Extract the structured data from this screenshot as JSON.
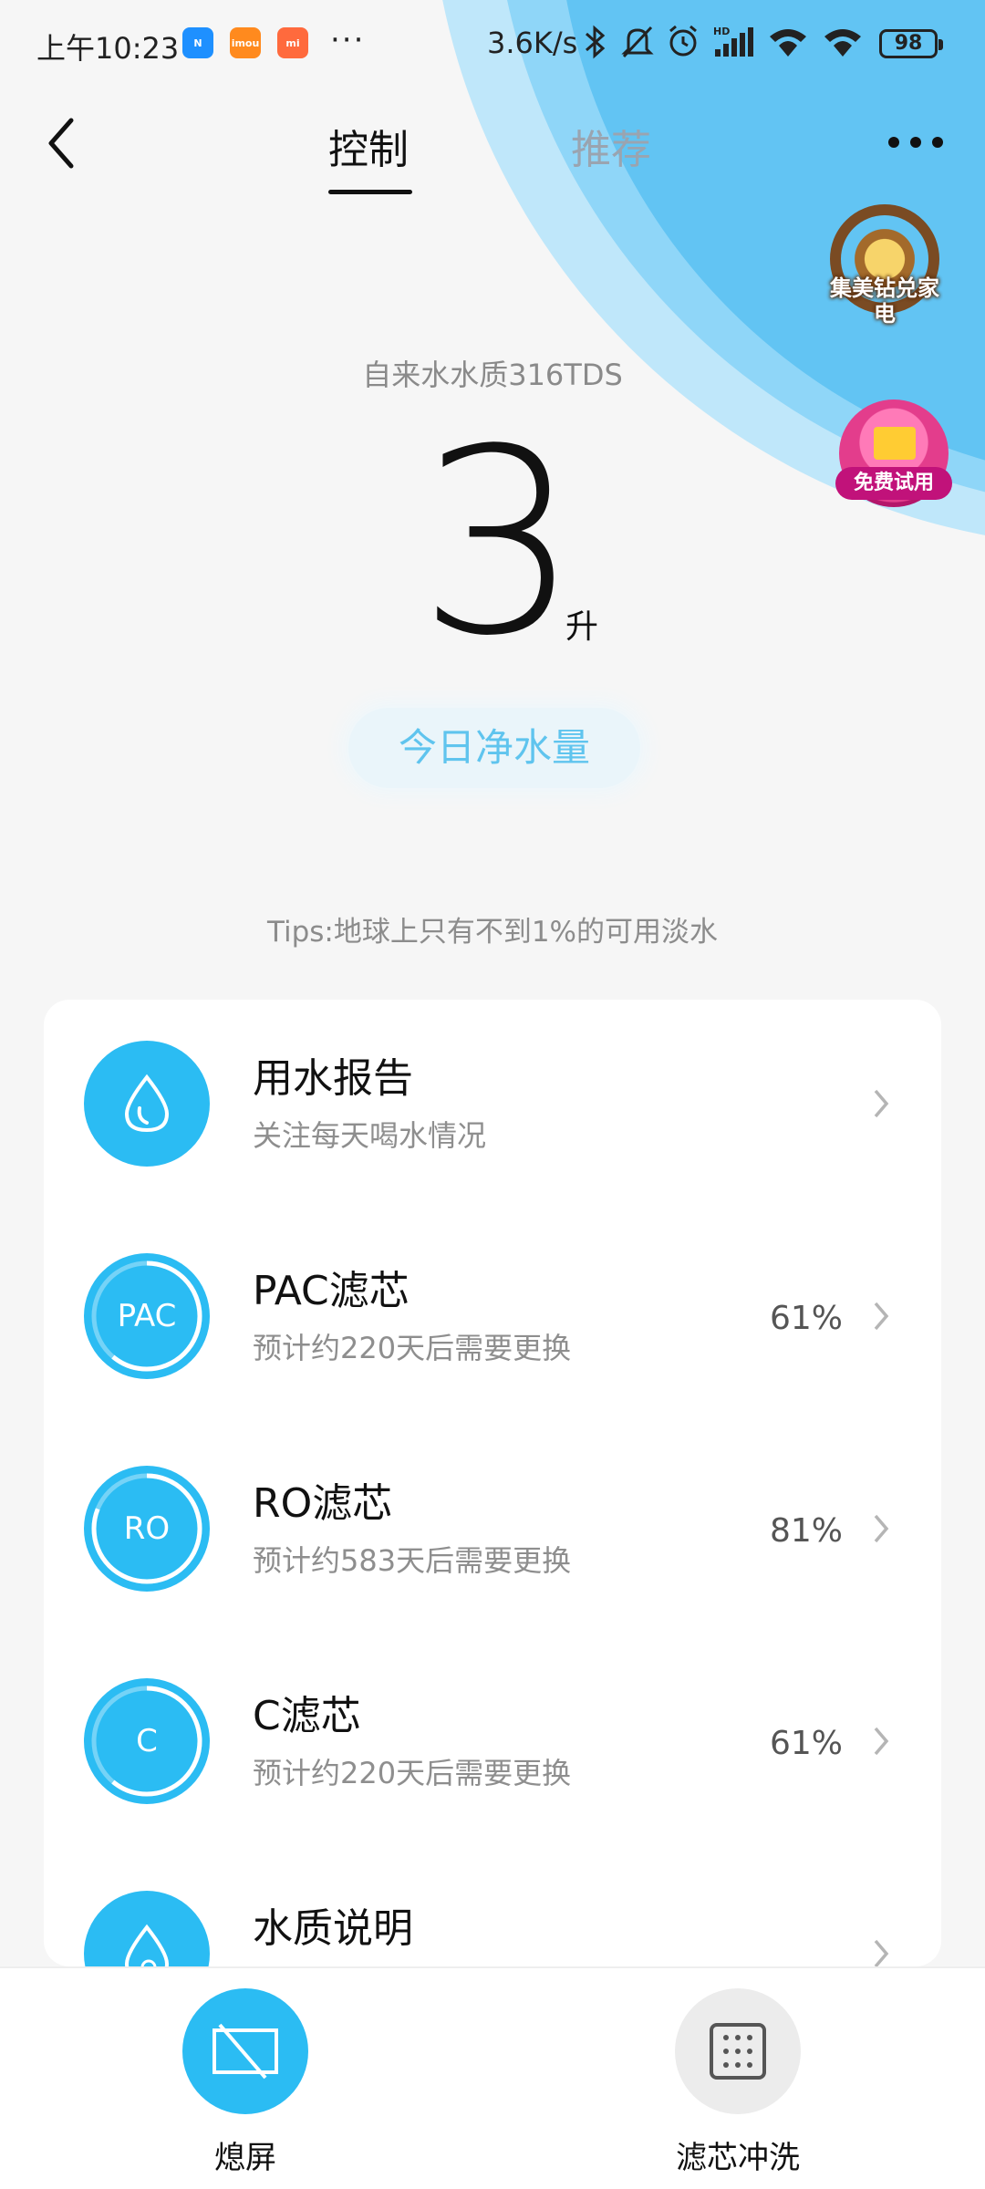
{
  "status_bar": {
    "time": "上午10:23",
    "app_icons": [
      "N",
      "imou",
      "mi"
    ],
    "overflow": "···",
    "net_speed": "3.6K/s",
    "battery": "98"
  },
  "header": {
    "tabs": [
      {
        "label": "控制",
        "active": true
      },
      {
        "label": "推荐",
        "active": false
      }
    ]
  },
  "promos": {
    "diamond": "集美钻兑家电",
    "trial": "免费试用"
  },
  "hero": {
    "tds_label": "自来水水质316TDS",
    "water_amount": "3",
    "unit": "升",
    "today_label": "今日净水量",
    "tips": "Tips:地球上只有不到1%的可用淡水"
  },
  "items": [
    {
      "title": "用水报告",
      "subtitle": "关注每天喝水情况",
      "icon": "water-drop-icon",
      "percent": ""
    },
    {
      "title": "PAC滤芯",
      "subtitle": "预计约220天后需要更换",
      "icon_text": "PAC",
      "percent": "61%",
      "level": 0.61
    },
    {
      "title": "RO滤芯",
      "subtitle": "预计约583天后需要更换",
      "icon_text": "RO",
      "percent": "81%",
      "level": 0.81
    },
    {
      "title": "C滤芯",
      "subtitle": "预计约220天后需要更换",
      "icon_text": "C",
      "percent": "61%",
      "level": 0.61
    },
    {
      "title": "水质说明",
      "subtitle": "",
      "icon": "water-quality-icon",
      "percent": ""
    }
  ],
  "bottom_bar": {
    "screen_off_label": "熄屏",
    "flush_label": "滤芯冲洗"
  },
  "colors": {
    "accent": "#2bbcf3",
    "pill_text": "#5fc4ee",
    "muted_text": "#8e8e8e"
  }
}
